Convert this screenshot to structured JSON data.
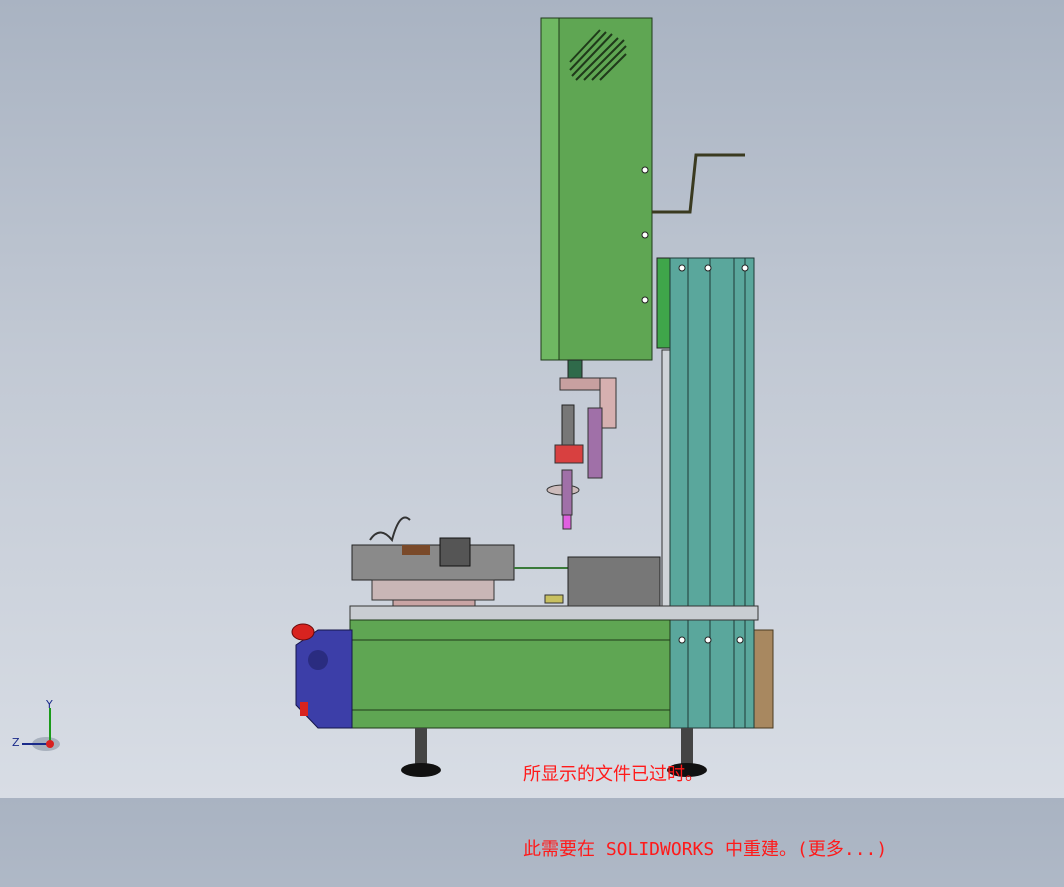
{
  "model_view": {
    "notice_line1": "所显示的文件已过时。",
    "notice_line2": "此需要在 SOLIDWORKS 中重建。(更多...)",
    "axis_y": "Y",
    "axis_z": "Z",
    "colors": {
      "housing_green": "#5fa653",
      "housing_dark": "#3f7a37",
      "column_teal": "#5aa79c",
      "base_blue": "#3c3ea8",
      "stop_red": "#d8231f",
      "backplate_brown": "#a88860",
      "notice_red": "#ff1a1a"
    }
  }
}
